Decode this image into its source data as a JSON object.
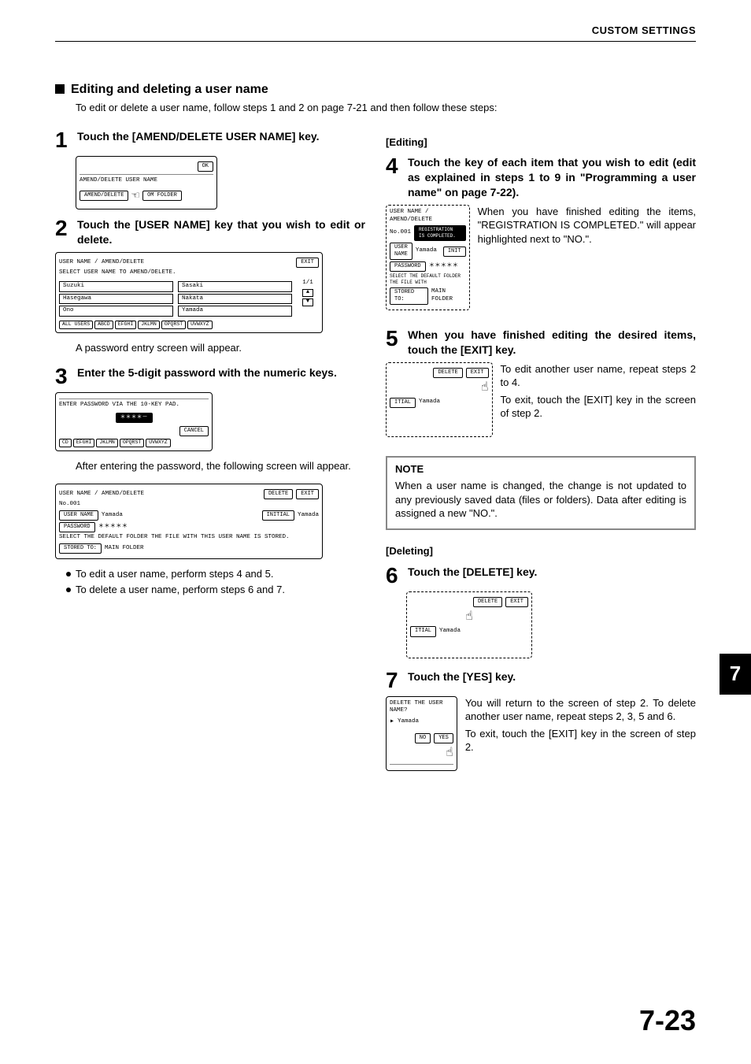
{
  "header": {
    "title": "CUSTOM SETTINGS"
  },
  "section": {
    "title": "Editing and deleting a user name",
    "subtitle": "To edit or delete a user name, follow steps 1 and 2 on page 7-21 and then follow these steps:"
  },
  "left": {
    "step1": {
      "num": "1",
      "text": "Touch the [AMEND/DELETE USER NAME] key."
    },
    "screen1": {
      "ok": "OK",
      "line": "AMEND/DELETE USER NAME",
      "btn1": "AMEND/DELETE",
      "btn2": "OM FOLDER"
    },
    "step2": {
      "num": "2",
      "text": "Touch the [USER NAME] key that you wish to edit or delete."
    },
    "screen2": {
      "title": "USER NAME / AMEND/DELETE",
      "prompt": "SELECT USER NAME TO AMEND/DELETE.",
      "exit": "EXIT",
      "names": [
        "Suzuki",
        "Sasaki",
        "Hasegawa",
        "Nakata",
        "Ono",
        "Yamada"
      ],
      "page": "1/1",
      "tabs": [
        "ALL USERS",
        "ABCD",
        "EFGHI",
        "JKLMN",
        "OPQRST",
        "UVWXYZ"
      ]
    },
    "after2": "A password entry screen will appear.",
    "step3": {
      "num": "3",
      "text": "Enter the 5-digit password with the numeric keys."
    },
    "screen3": {
      "prompt": "ENTER PASSWORD VIA THE 10-KEY PAD.",
      "mask": "＊＊＊＊－",
      "cancel": "CANCEL",
      "tabs": [
        "CD",
        "EFGHI",
        "JKLMN",
        "OPQRST",
        "UVWXYZ"
      ]
    },
    "after3": "After entering the password, the following screen will appear.",
    "screen4": {
      "title": "USER NAME / AMEND/DELETE",
      "no": "No.001",
      "delete": "DELETE",
      "exit": "EXIT",
      "uname_label": "USER NAME",
      "uname_val": "Yamada",
      "initial_label": "INITIAL",
      "initial_val": "Yamada",
      "pwd_label": "PASSWORD",
      "pwd_val": "＊＊＊＊＊",
      "stored_prompt": "SELECT THE DEFAULT FOLDER THE FILE WITH THIS USER NAME IS STORED.",
      "stored_label": "STORED TO:",
      "stored_val": "MAIN FOLDER"
    },
    "bullets": {
      "b1": "To edit a user name, perform steps 4 and 5.",
      "b2": "To delete a user name, perform steps 6 and 7."
    }
  },
  "right": {
    "editing_heading": "[Editing]",
    "step4": {
      "num": "4",
      "text": "Touch the key of each item that you wish to edit (edit as explained in steps 1 to 9 in \"Programming a user name\" on page 7-22)."
    },
    "screen4": {
      "title": "USER NAME / AMEND/DELETE",
      "noline": "No.001",
      "reg": "REGISTRATION IS COMPLETED.",
      "uname_label": "USER NAME",
      "uname_val": "Yamada",
      "init": "INIT",
      "pwd_label": "PASSWORD",
      "pwd_val": "＊＊＊＊＊",
      "stored_prompt": "SELECT THE DEFAULT FOLDER THE FILE WITH",
      "stored_label": "STORED TO:",
      "stored_val": "MAIN FOLDER"
    },
    "step4_side": "When you have finished editing the items, \"REGISTRATION IS COMPLETED.\" will appear highlighted next to \"NO.\".",
    "step5": {
      "num": "5",
      "text": "When you have finished editing the desired items, touch the [EXIT] key."
    },
    "screen5": {
      "delete": "DELETE",
      "exit": "EXIT",
      "itial": "ITIAL",
      "val": "Yamada"
    },
    "step5_side1": "To edit another user name, repeat steps 2 to 4.",
    "step5_side2": "To exit, touch the [EXIT] key in the screen of step 2.",
    "note": {
      "title": "NOTE",
      "body": "When a user name is changed, the change is not updated to any previously saved data (files or folders). Data after editing is assigned a new \"NO.\"."
    },
    "deleting_heading": "[Deleting]",
    "step6": {
      "num": "6",
      "text": "Touch the [DELETE] key."
    },
    "screen6": {
      "delete": "DELETE",
      "exit": "EXIT",
      "itial": "ITIAL",
      "val": "Yamada"
    },
    "step7": {
      "num": "7",
      "text": "Touch the [YES] key."
    },
    "screen7": {
      "prompt": "DELETE THE USER NAME?",
      "name": "Yamada",
      "no": "NO",
      "yes": "YES"
    },
    "step7_side1": "You will return to the screen of step 2. To delete another user name, repeat steps 2, 3, 5 and 6.",
    "step7_side2": "To exit, touch the [EXIT] key in the screen of step 2."
  },
  "side_tab": "7",
  "page_number": "7-23"
}
